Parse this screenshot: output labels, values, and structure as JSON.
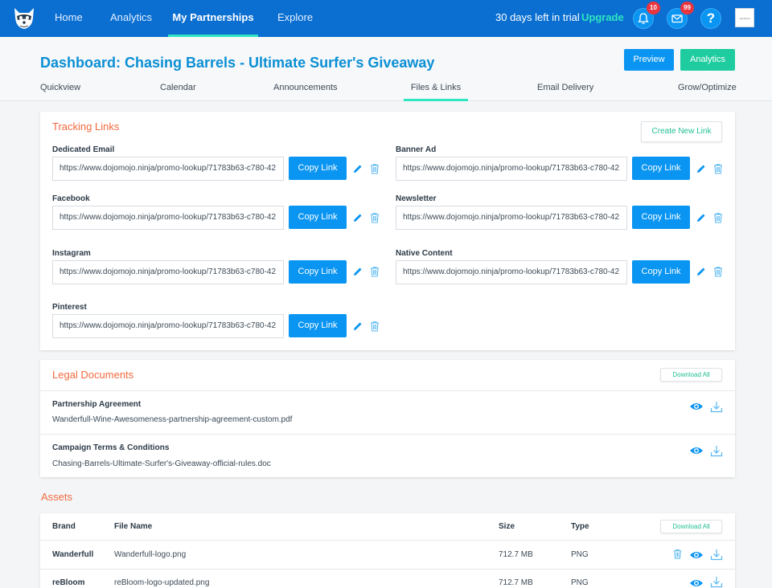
{
  "colors": {
    "nav_bg": "#0a6fd1",
    "accent_teal": "#2ee6c0",
    "primary_blue": "#0a95f2",
    "green": "#1fcc9f",
    "orange": "#f26a3f",
    "badge_red": "#e9353f"
  },
  "nav": {
    "logo_icon": "raccoon-logo-icon",
    "items": [
      "Home",
      "Analytics",
      "My Partnerships",
      "Explore"
    ],
    "active": "My Partnerships",
    "trial_text": "30 days left in trial",
    "upgrade_label": "Upgrade",
    "notifications_count": "10",
    "messages_count": "99",
    "help_label": "?",
    "account_logo_text": "wanderful"
  },
  "header": {
    "title": "Dashboard: Chasing Barrels - Ultimate Surfer's Giveaway",
    "preview_label": "Preview",
    "analytics_label": "Analytics",
    "tabs": [
      "Quickview",
      "Calendar",
      "Announcements",
      "Files & Links",
      "Email Delivery",
      "Grow/Optimize"
    ],
    "active_tab": "Files & Links"
  },
  "tracking": {
    "title": "Tracking Links",
    "create_label": "Create New Link",
    "copy_label": "Copy Link",
    "links": [
      {
        "label": "Dedicated Email",
        "url": "https://www.dojomojo.ninja/promo-lookup/71783b63-c780-42"
      },
      {
        "label": "Banner Ad",
        "url": "https://www.dojomojo.ninja/promo-lookup/71783b63-c780-42"
      },
      {
        "label": "Facebook",
        "url": "https://www.dojomojo.ninja/promo-lookup/71783b63-c780-42"
      },
      {
        "label": "Newsletter",
        "url": "https://www.dojomojo.ninja/promo-lookup/71783b63-c780-42"
      },
      {
        "label": "Instagram",
        "url": "https://www.dojomojo.ninja/promo-lookup/71783b63-c780-42"
      },
      {
        "label": "Native Content",
        "url": "https://www.dojomojo.ninja/promo-lookup/71783b63-c780-42"
      },
      {
        "label": "Pinterest",
        "url": "https://www.dojomojo.ninja/promo-lookup/71783b63-c780-42"
      }
    ]
  },
  "legal": {
    "title": "Legal Documents",
    "download_all_label": "Download All",
    "docs": [
      {
        "title": "Partnership Agreement",
        "file": "Wanderfull-Wine-Awesomeness-partnership-agreement-custom.pdf"
      },
      {
        "title": "Campaign Terms & Conditions",
        "file": "Chasing-Barrels-Ultimate-Surfer's-Giveaway-official-rules.doc"
      }
    ]
  },
  "assets": {
    "title": "Assets",
    "download_all_label": "Download All",
    "columns": [
      "Brand",
      "File Name",
      "Size",
      "Type"
    ],
    "rows": [
      {
        "brand": "Wanderfull",
        "file": "Wanderfull-logo.png",
        "size": "712.7 MB",
        "type": "PNG"
      },
      {
        "brand": "reBloom",
        "file": "reBloom-logo-updated.png",
        "size": "712.7 MB",
        "type": "PNG"
      }
    ]
  }
}
